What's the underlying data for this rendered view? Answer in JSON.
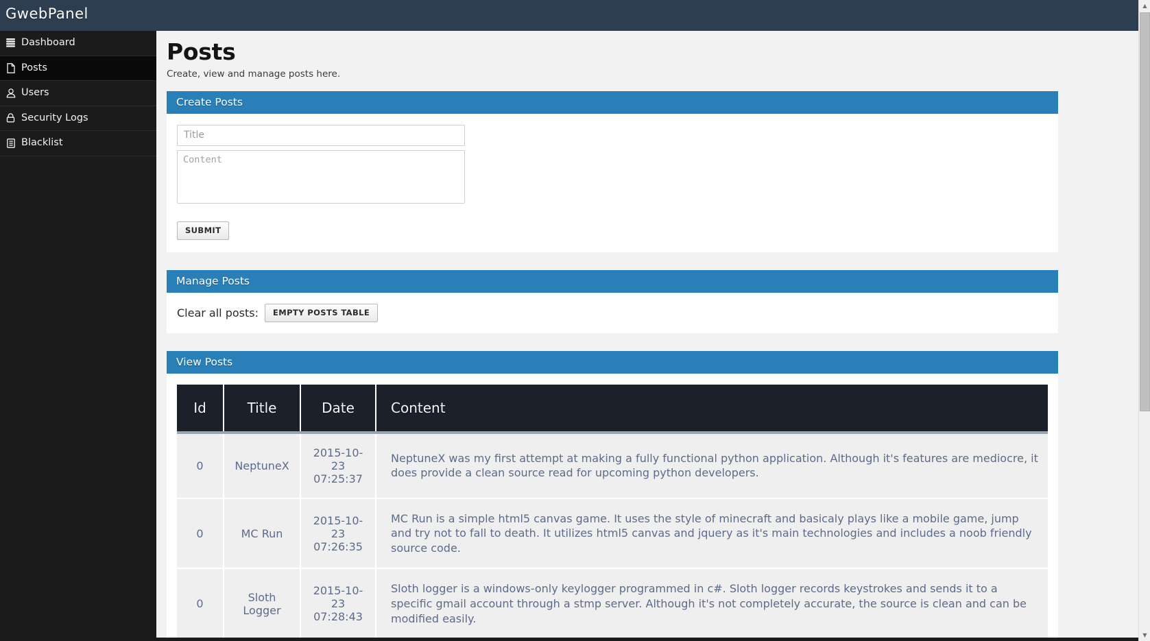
{
  "topbar": {
    "brand": "GwebPanel"
  },
  "sidebar": {
    "items": [
      {
        "label": "Dashboard",
        "icon": "database-icon",
        "active": false
      },
      {
        "label": "Posts",
        "icon": "file-icon",
        "active": true
      },
      {
        "label": "Users",
        "icon": "user-icon",
        "active": false
      },
      {
        "label": "Security Logs",
        "icon": "lock-icon",
        "active": false
      },
      {
        "label": "Blacklist",
        "icon": "list-icon",
        "active": false
      }
    ]
  },
  "page": {
    "title": "Posts",
    "subtitle": "Create, view and manage posts here."
  },
  "create_panel": {
    "heading": "Create Posts",
    "title_placeholder": "Title",
    "title_value": "",
    "content_placeholder": "Content",
    "content_value": "",
    "submit_label": "SUBMIT"
  },
  "manage_panel": {
    "heading": "Manage Posts",
    "clear_label": "Clear all posts:",
    "empty_button_label": "EMPTY POSTS TABLE"
  },
  "view_panel": {
    "heading": "View Posts",
    "columns": [
      "Id",
      "Title",
      "Date",
      "Content"
    ],
    "rows": [
      {
        "id": "0",
        "title": "NeptuneX",
        "date": "2015-10-23 07:25:37",
        "content": "NeptuneX was my first attempt at making a fully functional python application. Although it's features are mediocre, it does provide a clean source read for upcoming python developers."
      },
      {
        "id": "0",
        "title": "MC Run",
        "date": "2015-10-23 07:26:35",
        "content": "MC Run is a simple html5 canvas game. It uses the style of minecraft and basicaly plays like a mobile game, jump and try not to fall to death. It utilizes html5 canvas and jquery as it's main technologies and includes a noob friendly source code."
      },
      {
        "id": "0",
        "title": "Sloth Logger",
        "date": "2015-10-23 07:28:43",
        "content": "Sloth logger is a windows-only keylogger programmed in c#. Sloth logger records keystrokes and sends it to a specific gmail account through a stmp server. Although it's not completely accurate, the source is clean and can be modified easily."
      }
    ]
  },
  "scrollbar": {
    "up_glyph": "▲",
    "down_glyph": "▼"
  },
  "colors": {
    "topbar": "#2c3e50",
    "sidebar": "#1b1b1b",
    "panel_header": "#2980b9",
    "table_header": "#1b202b",
    "table_text": "#5c6b8a"
  }
}
